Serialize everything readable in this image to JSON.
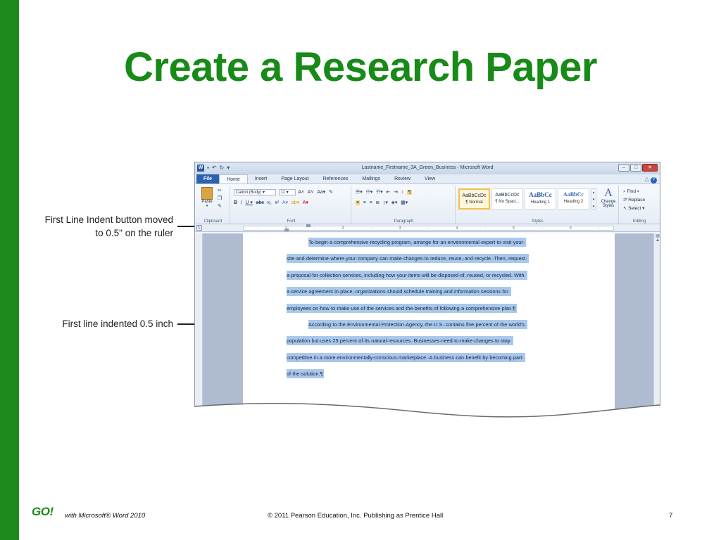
{
  "slide": {
    "title": "Create a Research Paper",
    "footer_product": "with Microsoft® Word 2010",
    "footer_copyright": "© 2011 Pearson Education, Inc. Publishing as Prentice Hall",
    "page_number": "7",
    "logo_text": "GO!"
  },
  "callouts": {
    "first_line_indent_button": "First Line Indent button moved to 0.5\" on the ruler",
    "first_line_indented": "First line indented 0.5 inch"
  },
  "word": {
    "window_title": "Lastname_Firstname_3A_Green_Business - Microsoft Word",
    "tabs": [
      "File",
      "Home",
      "Insert",
      "Page Layout",
      "References",
      "Mailings",
      "Review",
      "View"
    ],
    "active_tab": "Home",
    "clipboard": {
      "paste_label": "Paste",
      "group_label": "Clipboard"
    },
    "font": {
      "font_name": "Calibri (Body)",
      "font_size": "11",
      "group_label": "Font"
    },
    "paragraph": {
      "group_label": "Paragraph"
    },
    "styles": {
      "items": [
        {
          "sample": "AaBbCcDc",
          "name": "¶ Normal"
        },
        {
          "sample": "AaBbCcDc",
          "name": "¶ No Spaci..."
        },
        {
          "sample": "AaBbCc",
          "name": "Heading 1"
        },
        {
          "sample": "AaBbCc",
          "name": "Heading 2"
        }
      ],
      "change_styles": "Change Styles",
      "group_label": "Styles"
    },
    "editing": {
      "find": "Find",
      "replace": "Replace",
      "select": "Select",
      "group_label": "Editing"
    },
    "document_lines": [
      "To·begin·a·comprehensive·recycling·program,·arrange·for·an·environmental·expert·to·visit·your·",
      "site·and·determine·where·your·company·can·make·changes·to·reduce,·reuse,·and·recycle.·Then,·request·",
      "a·proposal·for·collection·services,·including·how·your·items·will·be·disposed·of,·reused,·or·recycled.·With·",
      "a·service·agreement·in·place,·organizations·should·schedule·training·and·information·sessions·for·",
      "employees·on·how·to·make·use·of·the·services·and·the·benefits·of·following·a·comprehensive·plan.¶",
      "According·to·the·Environmental·Protection·Agency,·the·U.S.·contains·five·percent·of·the·world's·",
      "population·but·uses·25·percent·of·its·natural·resources.·Businesses·need·to·make·changes·to·stay·",
      "competitive·in·a·more·environmentally-conscious·marketplace.·A·business·can·benefit·by·becoming·part·",
      "of·the·solution.¶"
    ]
  }
}
